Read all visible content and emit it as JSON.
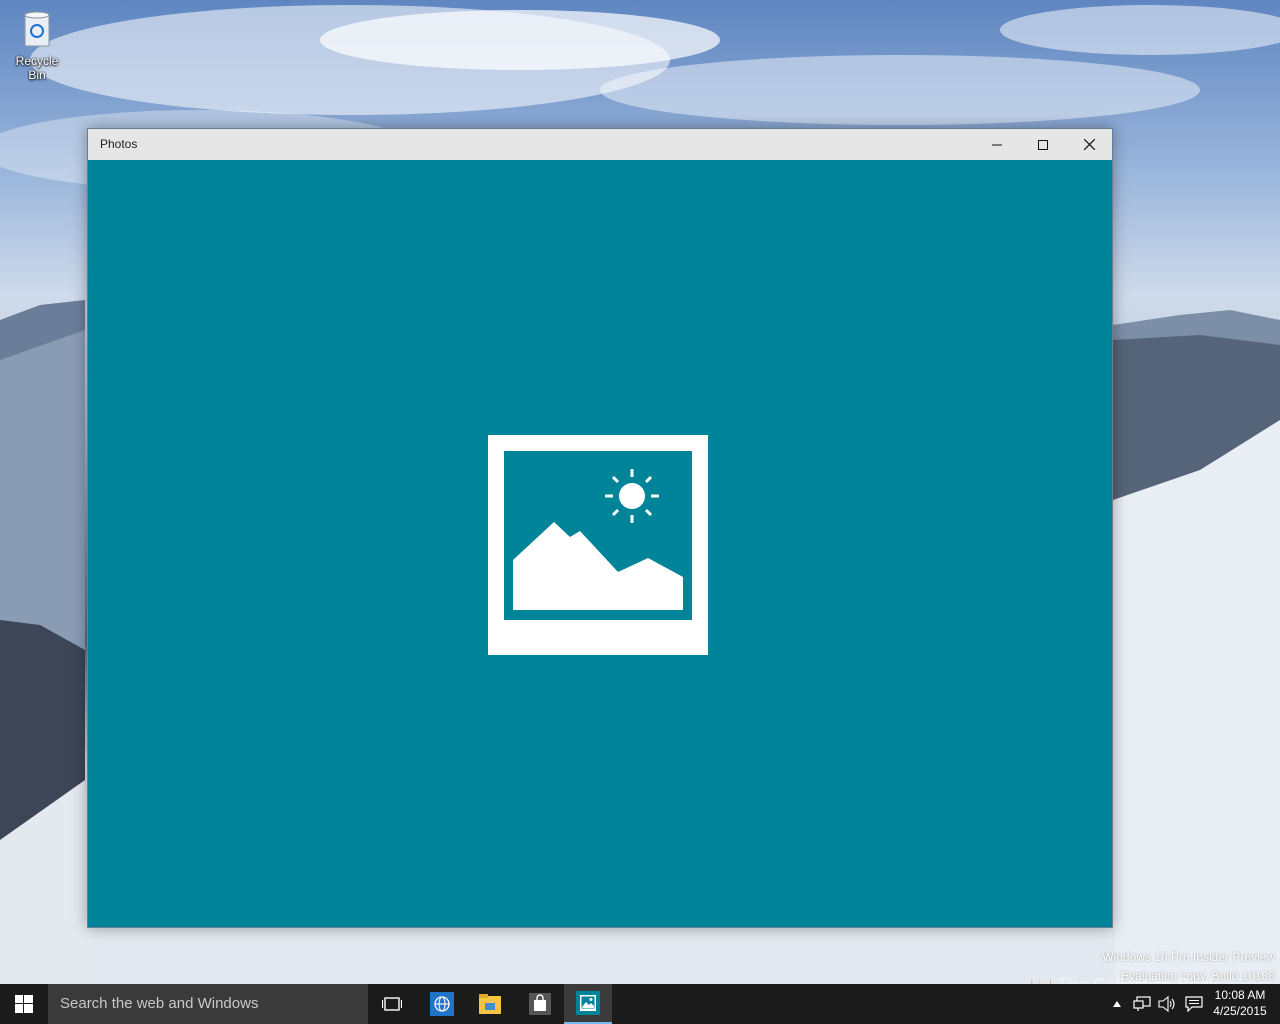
{
  "desktop": {
    "icons": [
      {
        "label": "Recycle Bin",
        "icon": "recycle-bin-icon"
      }
    ],
    "watermark": {
      "line1": "Windows 10 Pro Insider Preview",
      "line2": "Evaluation copy. Build 10108"
    },
    "brand_overlay": "The Collection Book"
  },
  "window": {
    "title": "Photos",
    "controls": {
      "minimize_icon": "minimize-icon",
      "maximize_icon": "maximize-icon",
      "close_icon": "close-icon"
    },
    "content": {
      "background_color": "#00849a",
      "center_icon": "photos-app-icon"
    }
  },
  "taskbar": {
    "start_icon": "windows-logo-icon",
    "search_placeholder": "Search the web and Windows",
    "pinned": [
      {
        "name": "task-view",
        "icon": "task-view-icon"
      },
      {
        "name": "internet-explorer",
        "icon": "globe-icon"
      },
      {
        "name": "file-explorer",
        "icon": "folder-icon"
      },
      {
        "name": "store",
        "icon": "store-icon"
      },
      {
        "name": "photos",
        "icon": "photos-icon",
        "active": true
      }
    ],
    "tray": {
      "icons": [
        "chevron-up-icon",
        "network-icon",
        "volume-icon",
        "action-center-icon"
      ],
      "time": "10:08 AM",
      "date": "4/25/2015"
    }
  },
  "colors": {
    "accent": "#00849a",
    "taskbar": "#1b1b1b",
    "search_box": "#3a3a3a",
    "active_indicator": "#76b9ed"
  }
}
